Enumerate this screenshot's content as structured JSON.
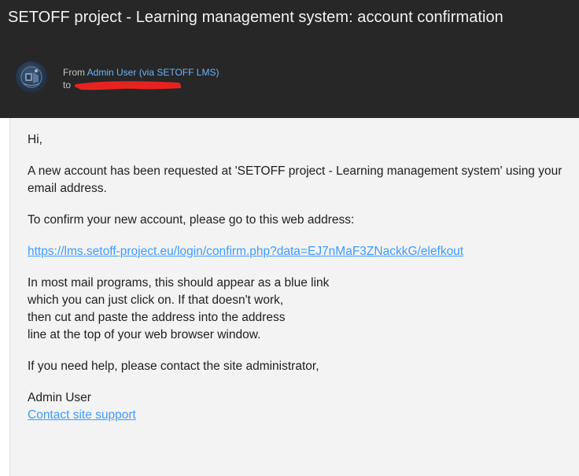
{
  "email": {
    "subject": "SETOFF project - Learning management system: account confirmation",
    "from_prefix": "From",
    "sender_name": "Admin User (via SETOFF LMS)",
    "to_prefix": "to",
    "greeting": "Hi,",
    "paragraph1": "A new account has been requested at 'SETOFF project - Learning management system' using your email address.",
    "paragraph2": "To confirm your new account, please go to this web address:",
    "confirm_link": "https://lms.setoff-project.eu/login/confirm.php?data=EJ7nMaF3ZNackkG/elefkout",
    "paragraph3_lines": [
      "In most mail programs, this should appear as a blue link",
      "which you can just click on. If that doesn't work,",
      "then cut and paste the address into the address",
      "line at the top of your web browser window."
    ],
    "paragraph4": "If you need help, please contact the site administrator,",
    "signature": "Admin User",
    "support_link": "Contact site support"
  },
  "colors": {
    "header_bg": "#272727",
    "body_bg": "#f3f3f3",
    "link": "#3d9bff",
    "sender_link": "#6ab3ff",
    "redaction": "#e8231f"
  },
  "icons": {
    "avatar": "setoff-logo-avatar",
    "redaction": "red-redaction-scribble"
  }
}
